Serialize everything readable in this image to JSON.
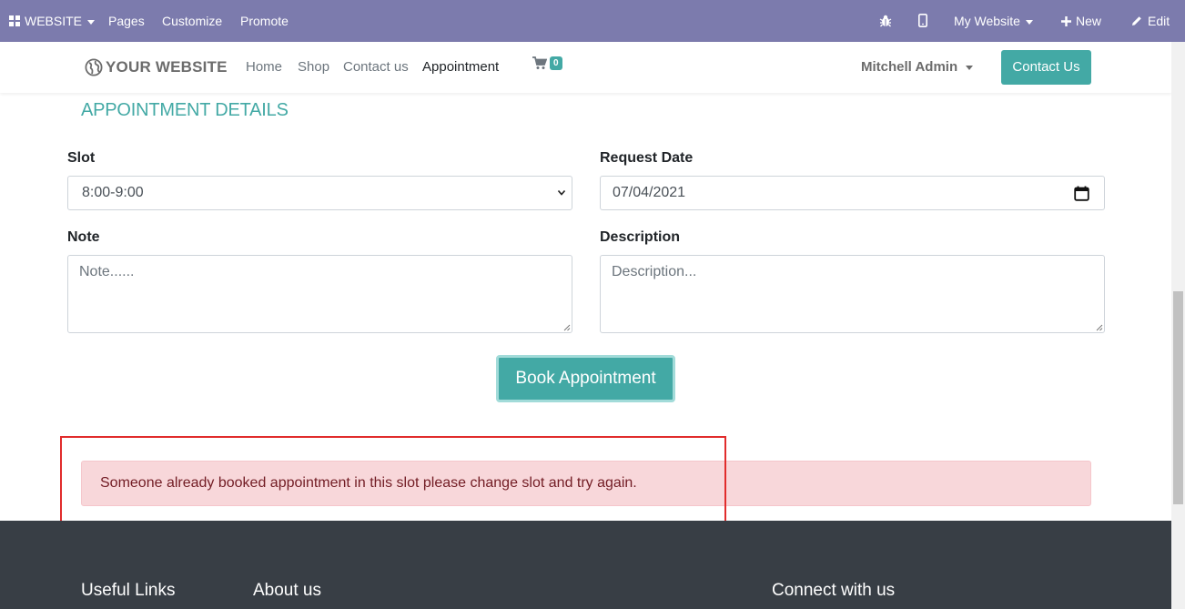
{
  "admin_bar": {
    "app_label": "WEBSITE",
    "menu": [
      "Pages",
      "Customize",
      "Promote"
    ],
    "site_selector": "My Website",
    "new_label": "New",
    "edit_label": "Edit"
  },
  "header": {
    "logo_text": "YOUR WEBSITE",
    "nav": [
      "Home",
      "Shop",
      "Contact us",
      "Appointment"
    ],
    "active_nav": "Appointment",
    "cart_count": "0",
    "user_name": "Mitchell Admin",
    "contact_button": "Contact Us"
  },
  "form": {
    "section_title": "APPOINTMENT DETAILS",
    "slot_label": "Slot",
    "slot_value": "8:00-9:00",
    "request_date_label": "Request Date",
    "request_date_value": "07/04/2021",
    "note_label": "Note",
    "note_placeholder": "Note......",
    "description_label": "Description",
    "description_placeholder": "Description...",
    "submit_label": "Book Appointment"
  },
  "alert": {
    "message": "Someone already booked appointment in this slot please change slot and try again."
  },
  "footer": {
    "headings": [
      "Useful Links",
      "About us",
      "Connect with us"
    ]
  },
  "colors": {
    "admin_bar": "#7c7bad",
    "accent": "#43a9a5",
    "alert_bg": "#f8d7da",
    "alert_text": "#721c24",
    "highlight_border": "#e12c2c",
    "footer_bg": "#383e45"
  }
}
